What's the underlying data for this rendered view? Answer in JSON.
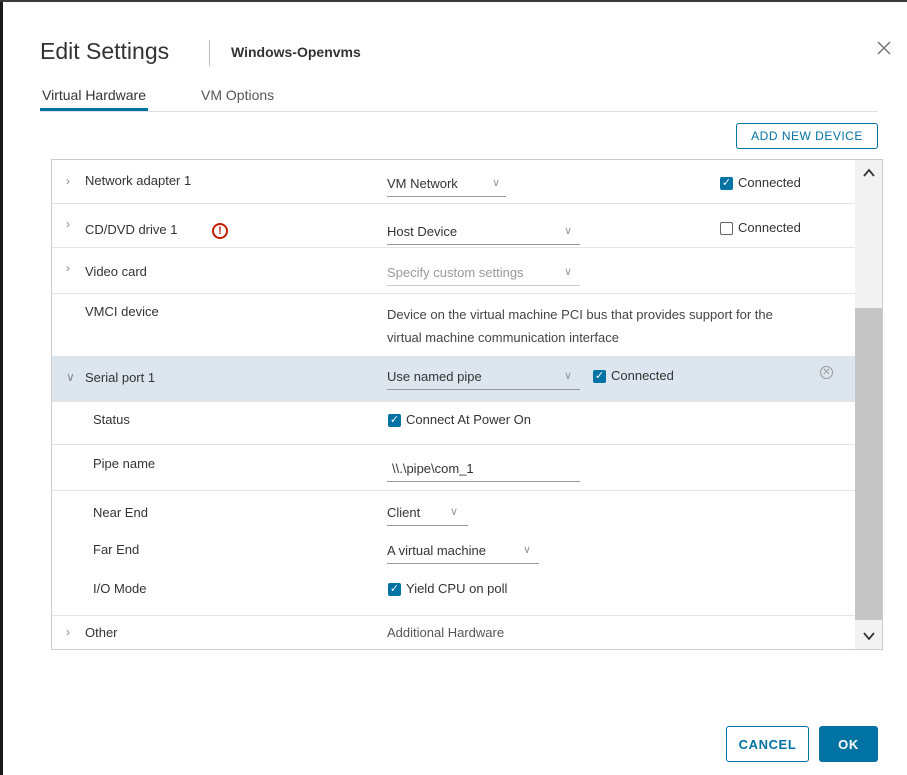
{
  "dialog": {
    "title": "Edit Settings",
    "vm_name": "Windows-Openvms",
    "close_icon": "close-icon"
  },
  "tabs": [
    {
      "label": "Virtual Hardware",
      "active": true
    },
    {
      "label": "VM Options",
      "active": false
    }
  ],
  "add_device_label": "ADD NEW DEVICE",
  "hardware": {
    "network_adapter": {
      "label": "Network adapter 1",
      "value": "VM Network",
      "connected_label": "Connected",
      "connected": true
    },
    "cd_dvd": {
      "label": "CD/DVD drive 1",
      "value": "Host Device",
      "connected_label": "Connected",
      "connected": false,
      "warning_icon": "warning-icon"
    },
    "video_card": {
      "label": "Video card",
      "value": "Specify custom settings"
    },
    "vmci": {
      "label": "VMCI device",
      "description_line1": "Device on the virtual machine PCI bus that provides support for the",
      "description_line2": "virtual machine communication interface"
    },
    "serial_port": {
      "label": "Serial port 1",
      "value": "Use named pipe",
      "connected_label": "Connected",
      "connected": true,
      "status": {
        "label": "Status",
        "option": "Connect At Power On",
        "checked": true
      },
      "pipe_name": {
        "label": "Pipe name",
        "value": "\\\\.\\pipe\\com_1"
      },
      "near_end": {
        "label": "Near End",
        "value": "Client"
      },
      "far_end": {
        "label": "Far End",
        "value": "A virtual machine"
      },
      "io_mode": {
        "label": "I/O Mode",
        "option": "Yield CPU on poll",
        "checked": true
      }
    },
    "other": {
      "label": "Other",
      "value": "Additional Hardware"
    }
  },
  "footer": {
    "cancel_label": "CANCEL",
    "ok_label": "OK"
  },
  "colors": {
    "accent": "#0072a3",
    "serial_row_bg": "#dde6ee",
    "warning": "#c21d00"
  }
}
